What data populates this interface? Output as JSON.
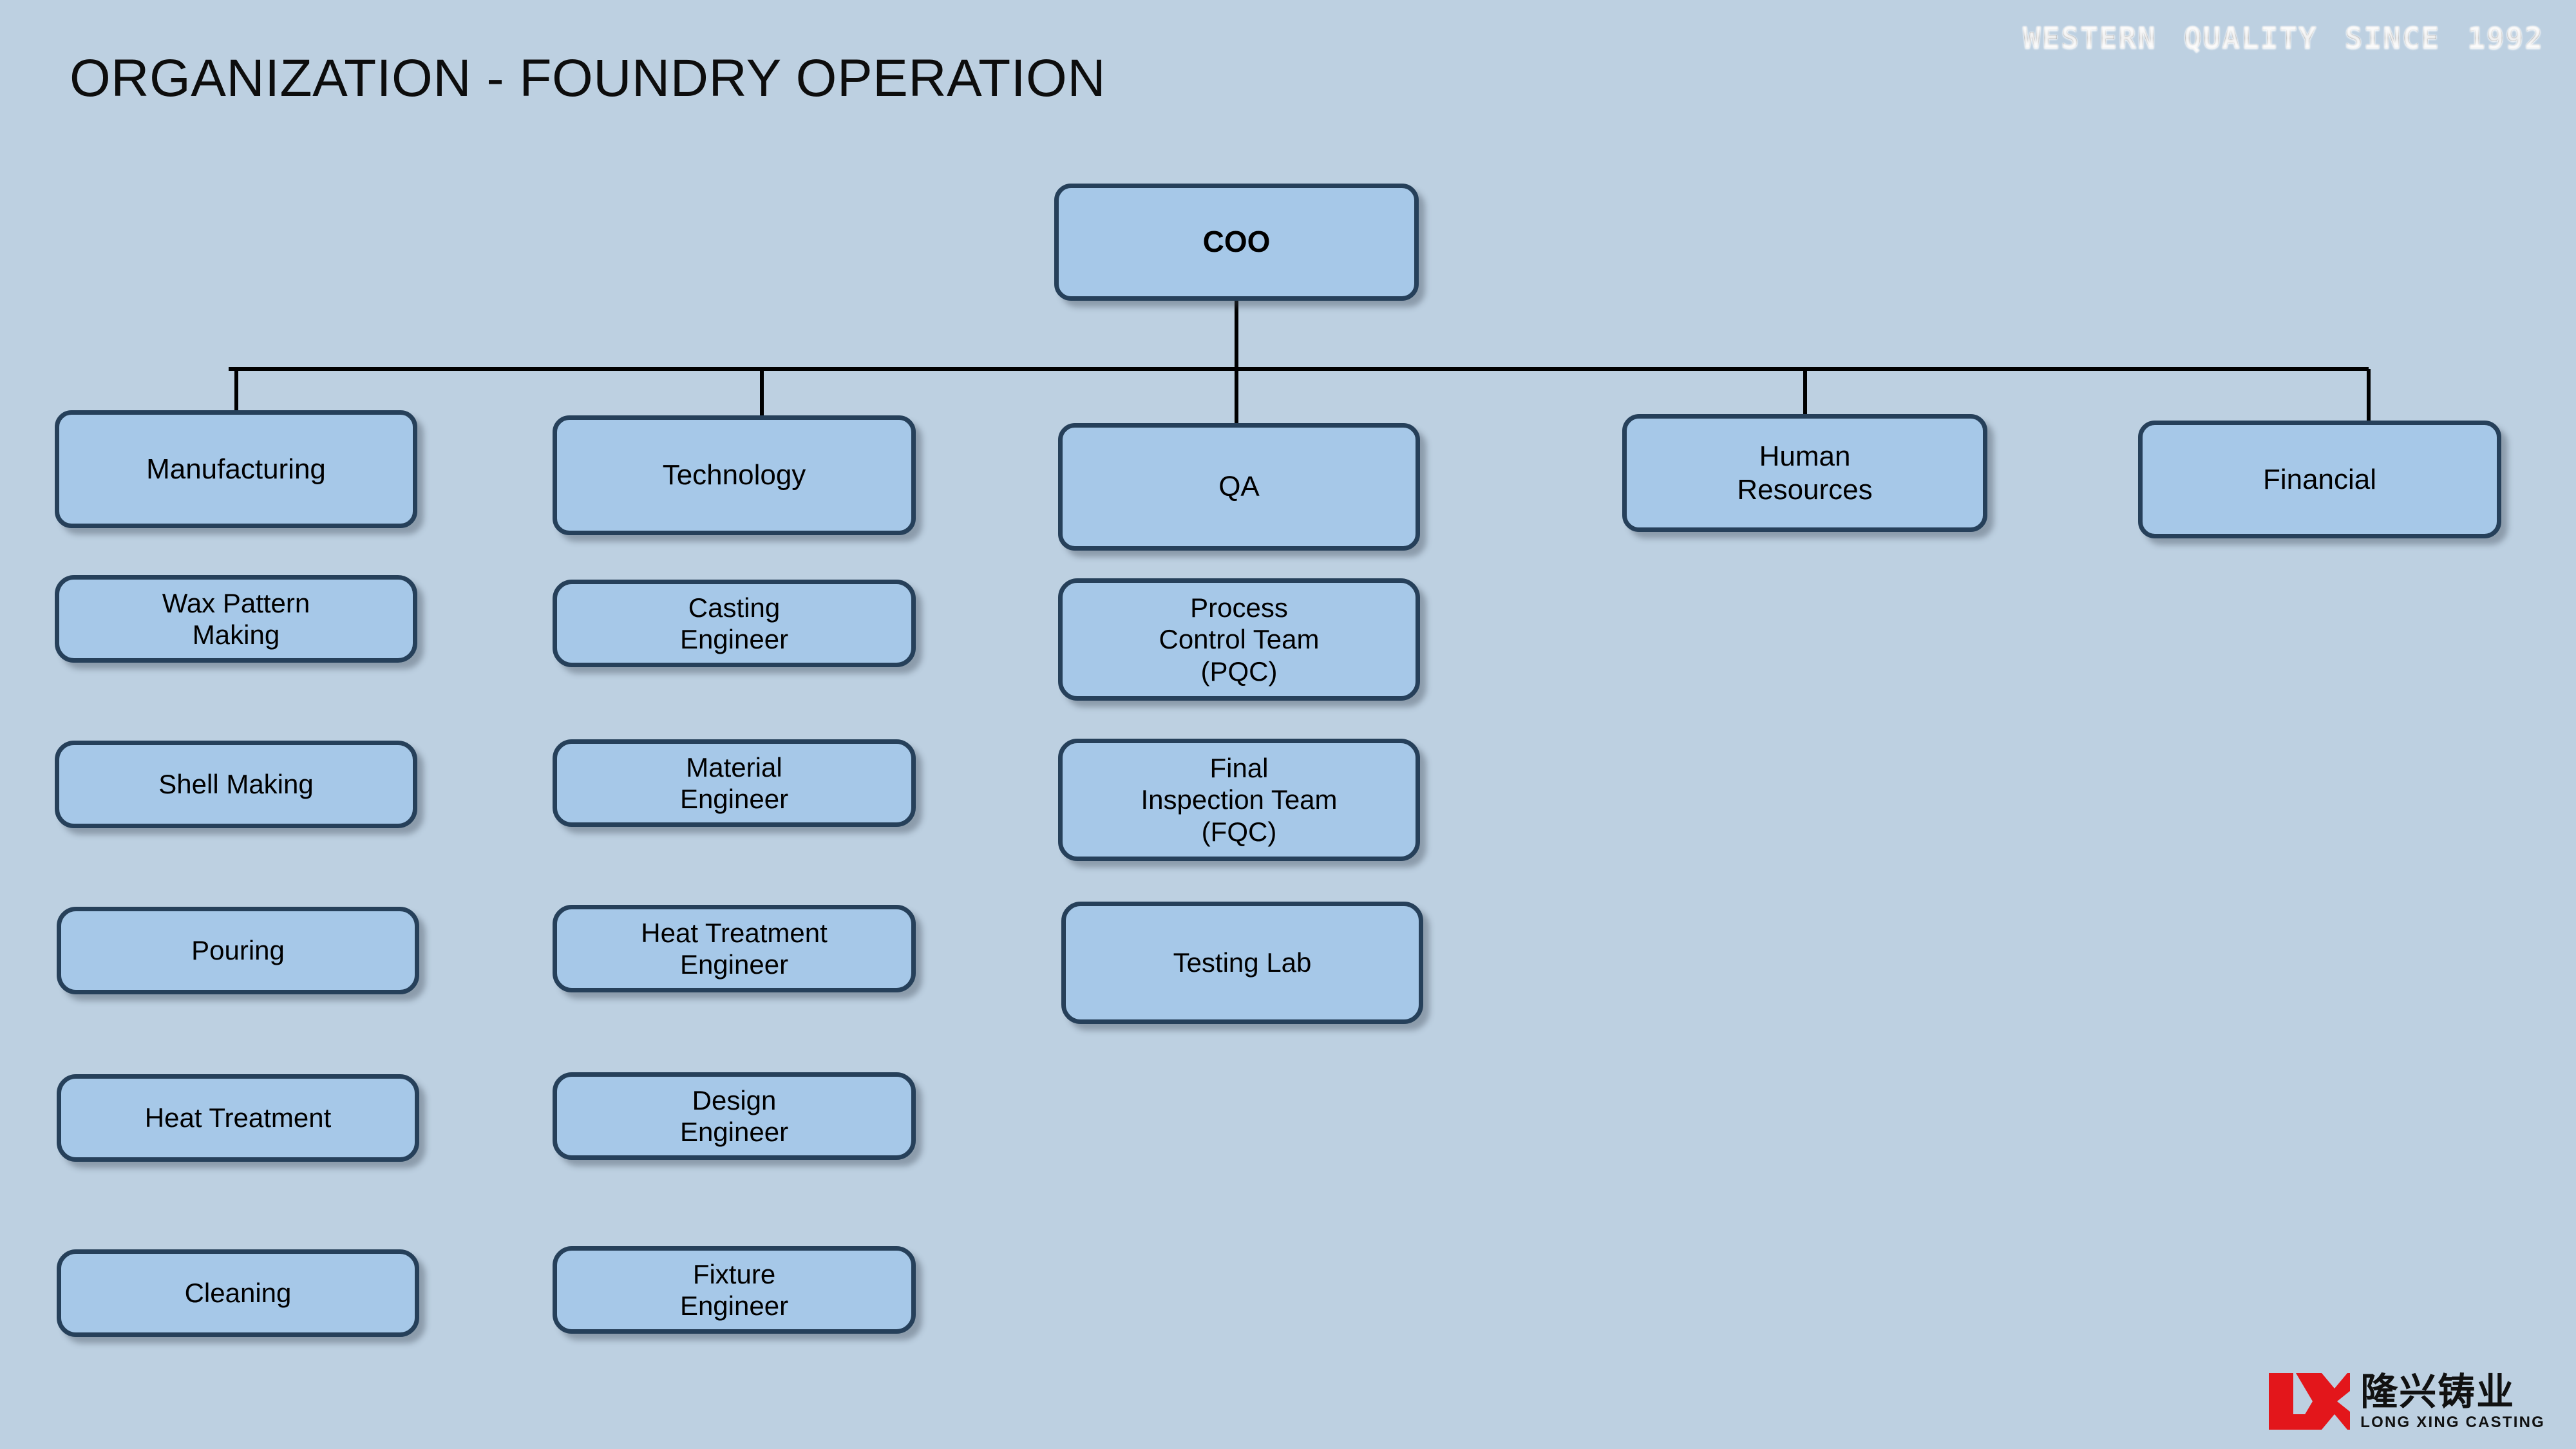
{
  "page": {
    "title": "ORGANIZATION - FOUNDRY OPERATION",
    "background_color": "#bdd0e1",
    "node_fill_color": "#a6c8e8",
    "node_border_color": "#26405a",
    "connector_color": "#000000"
  },
  "tagline": {
    "words": [
      "WESTERN",
      "QUALITY",
      "SINCE",
      "1992"
    ]
  },
  "chart_data": {
    "type": "org-chart",
    "root": {
      "label": "COO"
    },
    "departments": [
      {
        "label": "Manufacturing",
        "children": [
          {
            "label": "Wax Pattern\nMaking"
          },
          {
            "label": "Shell Making"
          },
          {
            "label": "Pouring"
          },
          {
            "label": "Heat Treatment"
          },
          {
            "label": "Cleaning"
          }
        ]
      },
      {
        "label": "Technology",
        "children": [
          {
            "label": "Casting\nEngineer"
          },
          {
            "label": "Material\nEngineer"
          },
          {
            "label": "Heat Treatment\nEngineer"
          },
          {
            "label": "Design\nEngineer"
          },
          {
            "label": "Fixture\nEngineer"
          }
        ]
      },
      {
        "label": "QA",
        "children": [
          {
            "label": "Process\nControl Team\n(PQC)"
          },
          {
            "label": "Final\nInspection Team\n(FQC)"
          },
          {
            "label": "Testing Lab"
          }
        ]
      },
      {
        "label": "Human\nResources",
        "children": []
      },
      {
        "label": "Financial",
        "children": []
      }
    ]
  },
  "logo": {
    "company_cn": "隆兴铸业",
    "company_en": "LONG XING CASTING",
    "mark_color": "#e3161b"
  }
}
